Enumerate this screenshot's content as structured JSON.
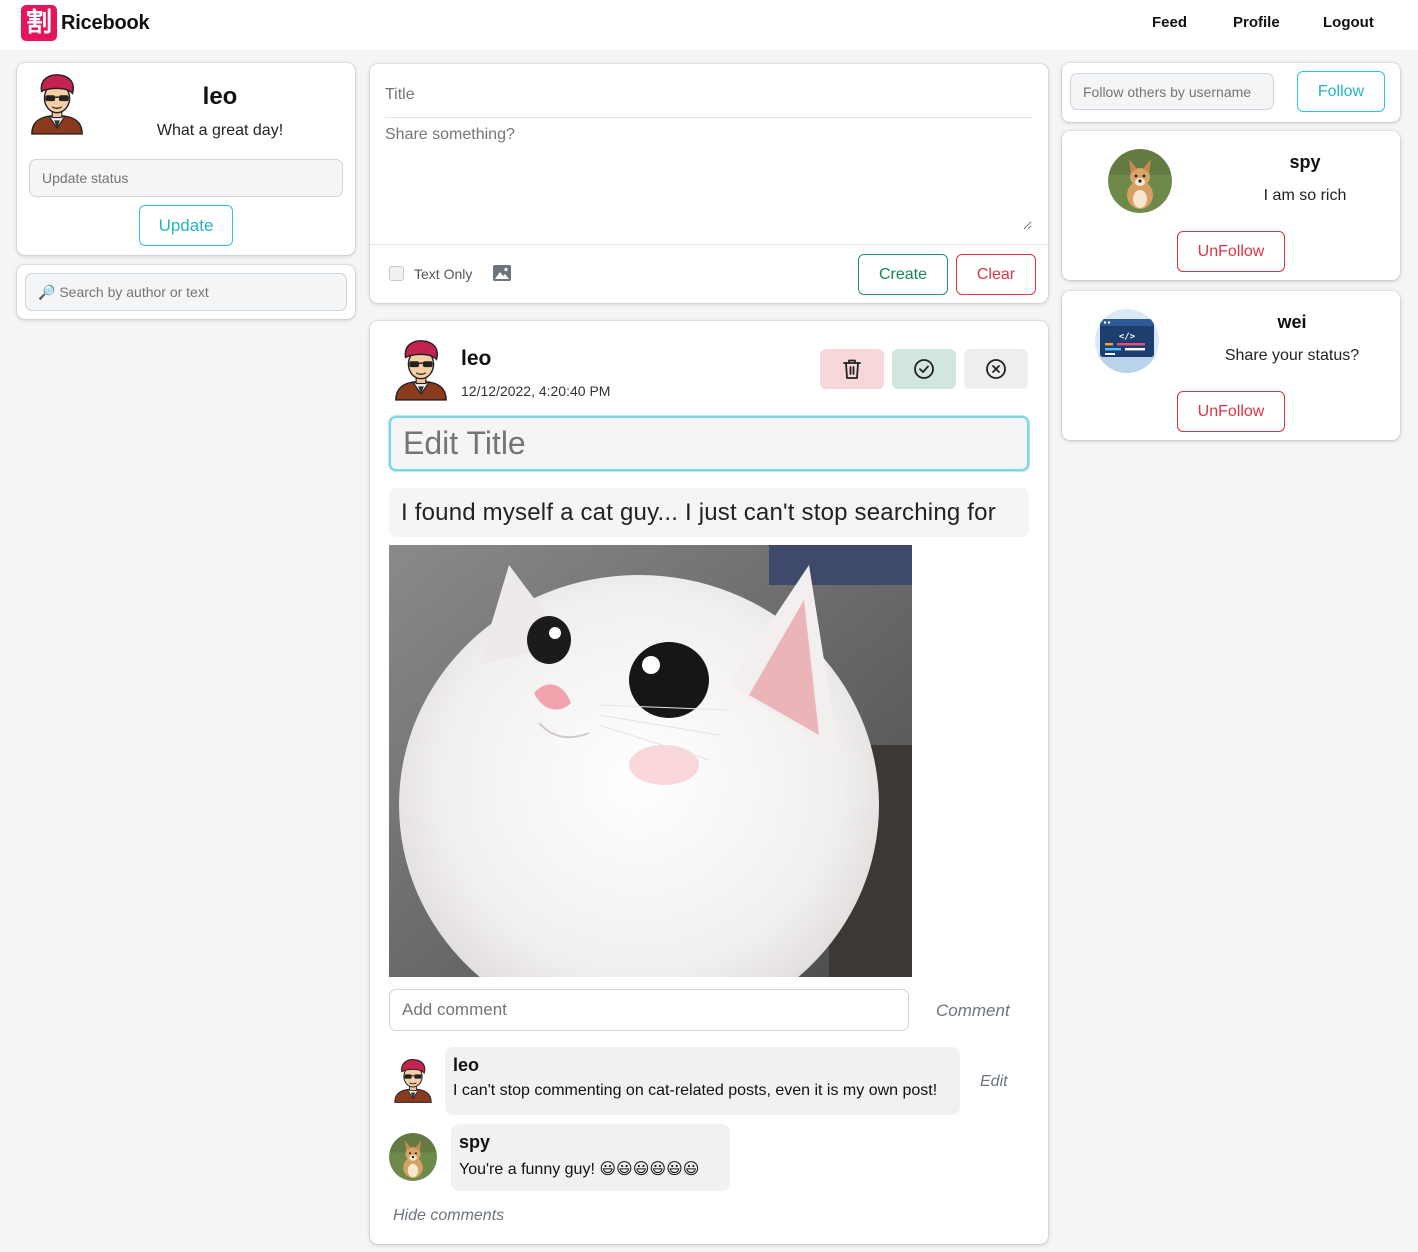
{
  "nav": {
    "logo_glyph": "割",
    "brand": "Ricebook",
    "links": [
      "Feed",
      "Profile",
      "Logout"
    ]
  },
  "profile": {
    "name": "leo",
    "status": "What a great day!",
    "status_placeholder": "Update status",
    "update_label": "Update"
  },
  "search": {
    "placeholder": "🔎 Search by author or text"
  },
  "composer": {
    "title_placeholder": "Title",
    "body_placeholder": "Share something?",
    "text_only_label": "Text Only",
    "create_label": "Create",
    "clear_label": "Clear"
  },
  "post": {
    "author": "leo",
    "timestamp": "12/12/2022, 4:20:40 PM",
    "edit_title_placeholder": "Edit Title",
    "body_text": "I found myself a cat guy... I just can't stop searching for",
    "comment_placeholder": "Add comment",
    "comment_label": "Comment",
    "hide_comments_label": "Hide comments",
    "comments": [
      {
        "author": "leo",
        "text": "I can't stop commenting on cat-related posts, even it is my own post!",
        "edit_label": "Edit"
      },
      {
        "author": "spy",
        "text": "You're a funny guy! 😃😃😃😃😃😃"
      }
    ]
  },
  "follow": {
    "placeholder": "Follow others by username",
    "button_label": "Follow"
  },
  "following": [
    {
      "name": "spy",
      "status": "I am so rich",
      "button_label": "UnFollow"
    },
    {
      "name": "wei",
      "status": "Share your status?",
      "button_label": "UnFollow"
    }
  ],
  "colors": {
    "brand": "#e6155b",
    "info": "#21b3c8",
    "success": "#198754",
    "danger": "#dc3545",
    "delete_bg": "#f8d7da",
    "confirm_bg": "#d1e7dd",
    "cancel_bg": "#eeeeef"
  },
  "icons": [
    "trash-icon",
    "check-circle-icon",
    "x-circle-icon",
    "image-icon",
    "search-icon"
  ]
}
